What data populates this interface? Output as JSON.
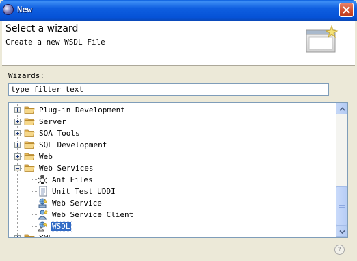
{
  "window": {
    "title": "New",
    "close_icon": "close-icon"
  },
  "banner": {
    "title": "Select a wizard",
    "description": "Create a new WSDL File",
    "art_icon": "new-wizard-banner-icon"
  },
  "filter": {
    "label": "Wizards:",
    "value": "type filter text"
  },
  "tree": {
    "items": [
      {
        "label": "Plug-in Development",
        "icon": "folder-icon",
        "level": 0,
        "state": "collapsed"
      },
      {
        "label": "Server",
        "icon": "folder-icon",
        "level": 0,
        "state": "collapsed"
      },
      {
        "label": "SOA Tools",
        "icon": "folder-icon",
        "level": 0,
        "state": "collapsed"
      },
      {
        "label": "SQL Development",
        "icon": "folder-icon",
        "level": 0,
        "state": "collapsed"
      },
      {
        "label": "Web",
        "icon": "folder-icon",
        "level": 0,
        "state": "collapsed"
      },
      {
        "label": "Web Services",
        "icon": "folder-icon",
        "level": 0,
        "state": "expanded"
      },
      {
        "label": "Ant Files",
        "icon": "ant-icon",
        "level": 1
      },
      {
        "label": "Unit Test UDDI",
        "icon": "document-icon",
        "level": 1
      },
      {
        "label": "Web Service",
        "icon": "web-service-icon",
        "level": 1
      },
      {
        "label": "Web Service Client",
        "icon": "web-service-client-icon",
        "level": 1
      },
      {
        "label": "WSDL",
        "icon": "wsdl-icon",
        "level": 1,
        "selected": true
      },
      {
        "label": "XML",
        "icon": "folder-icon",
        "level": 0,
        "state": "collapsed",
        "clipped": true
      }
    ]
  },
  "help": {
    "icon": "help-icon",
    "glyph": "?"
  }
}
